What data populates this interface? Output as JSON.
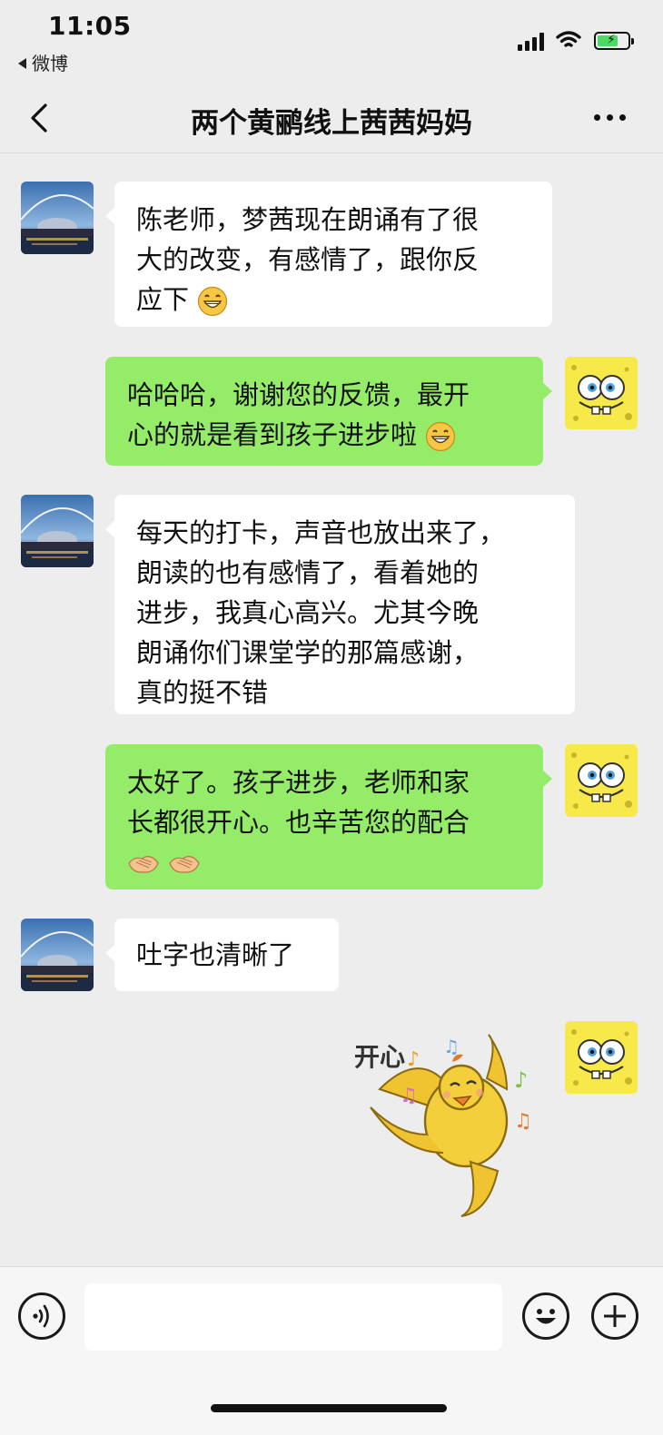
{
  "status_bar": {
    "time": "11:05",
    "back_app": "微博",
    "icons": [
      "signal-icon",
      "wifi-icon",
      "battery-charging-icon"
    ]
  },
  "nav": {
    "title": "两个黄鹂线上茜茜妈妈",
    "back_icon": "chevron-left-icon",
    "more_icon": "more-dots-icon"
  },
  "messages": [
    {
      "side": "left",
      "lines": [
        "陈老师，梦茜现在朗诵有了很",
        "大的改变，有感情了，跟你反",
        "应下"
      ],
      "emoji": "grin-emoji"
    },
    {
      "side": "right",
      "lines": [
        "哈哈哈，谢谢您的反馈，最开",
        "心的就是看到孩子进步啦"
      ],
      "emoji": "grin-emoji"
    },
    {
      "side": "left",
      "lines": [
        "每天的打卡，声音也放出来了，",
        "朗读的也有感情了，看着她的",
        "进步，我真心高兴。尤其今晚",
        "朗诵你们课堂学的那篇感谢，",
        "真的挺不错"
      ]
    },
    {
      "side": "right",
      "lines": [
        "太好了。孩子进步，老师和家",
        "长都很开心。也辛苦您的配合",
        ""
      ],
      "emoji": "handshake-emoji"
    },
    {
      "side": "left",
      "lines": [
        "吐字也清晰了"
      ]
    },
    {
      "side": "right",
      "sticker": "happy-yellow-bird-sticker",
      "sticker_text": "开心"
    }
  ],
  "input_bar": {
    "voice_icon": "voice-icon",
    "emoji_icon": "smiley-icon",
    "plus_icon": "plus-icon",
    "input_value": ""
  },
  "colors": {
    "background": "#ededed",
    "my_bubble": "#95ec69",
    "their_bubble": "#ffffff"
  }
}
